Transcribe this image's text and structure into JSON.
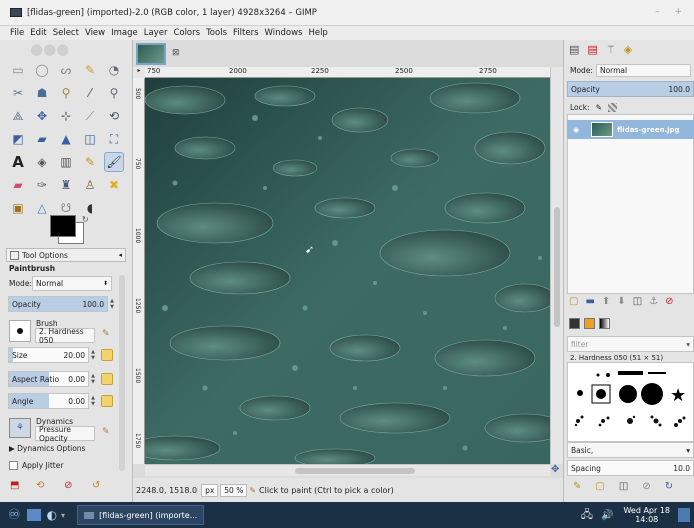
{
  "window": {
    "title": "[flidas-green] (imported)-2.0 (RGB color, 1 layer) 4928x3264 – GIMP",
    "controls": "– +"
  },
  "menu": [
    "File",
    "Edit",
    "Select",
    "View",
    "Image",
    "Layer",
    "Colors",
    "Tools",
    "Filters",
    "Windows",
    "Help"
  ],
  "ruler": {
    "ticks": [
      "750",
      "2000",
      "2250",
      "2500",
      "2750"
    ],
    "left_ticks": [
      "500",
      "750",
      "1000",
      "1250",
      "1500",
      "1750"
    ]
  },
  "tool_options": {
    "tab_label": "Tool Options",
    "tool_name": "Paintbrush",
    "mode_label": "Mode:",
    "mode_value": "Normal",
    "opacity_label": "Opacity",
    "opacity_value": "100.0",
    "opacity_level": 1.0,
    "brush_label": "Brush",
    "brush_value": "2. Hardness 050",
    "size_label": "Size",
    "size_value": "20.00",
    "size_level": 0.05,
    "aspect_label": "Aspect Ratio",
    "aspect_value": "0.00",
    "aspect_level": 0.5,
    "angle_label": "Angle",
    "angle_value": "0.00",
    "angle_level": 0.5,
    "dynamics_label": "Dynamics",
    "dynamics_value": "Pressure Opacity",
    "dynamics_options": "Dynamics Options",
    "apply_jitter": "Apply Jitter"
  },
  "status": {
    "coords": "2248.0, 1518.0",
    "unit": "px",
    "zoom": "50 %",
    "message": "Click to paint (Ctrl to pick a color)"
  },
  "layers": {
    "mode_label": "Mode:",
    "mode_value": "Normal",
    "opacity_label": "Opacity",
    "opacity_value": "100.0",
    "lock_label": "Lock:",
    "layer_name": "flidas-green.jpg"
  },
  "brushes": {
    "filter_placeholder": "filter",
    "selected": "2. Hardness 050 (51 × 51)",
    "tag": "Basic,",
    "spacing_label": "Spacing",
    "spacing_value": "10.0"
  },
  "taskbar": {
    "task_label": "[flidas-green] (importe...",
    "date": "Wed Apr 18",
    "time": "14:08"
  },
  "colors": {
    "accent": "#93b6dd",
    "canvas": "#2e5550",
    "taskbar": "#1b2f45"
  }
}
